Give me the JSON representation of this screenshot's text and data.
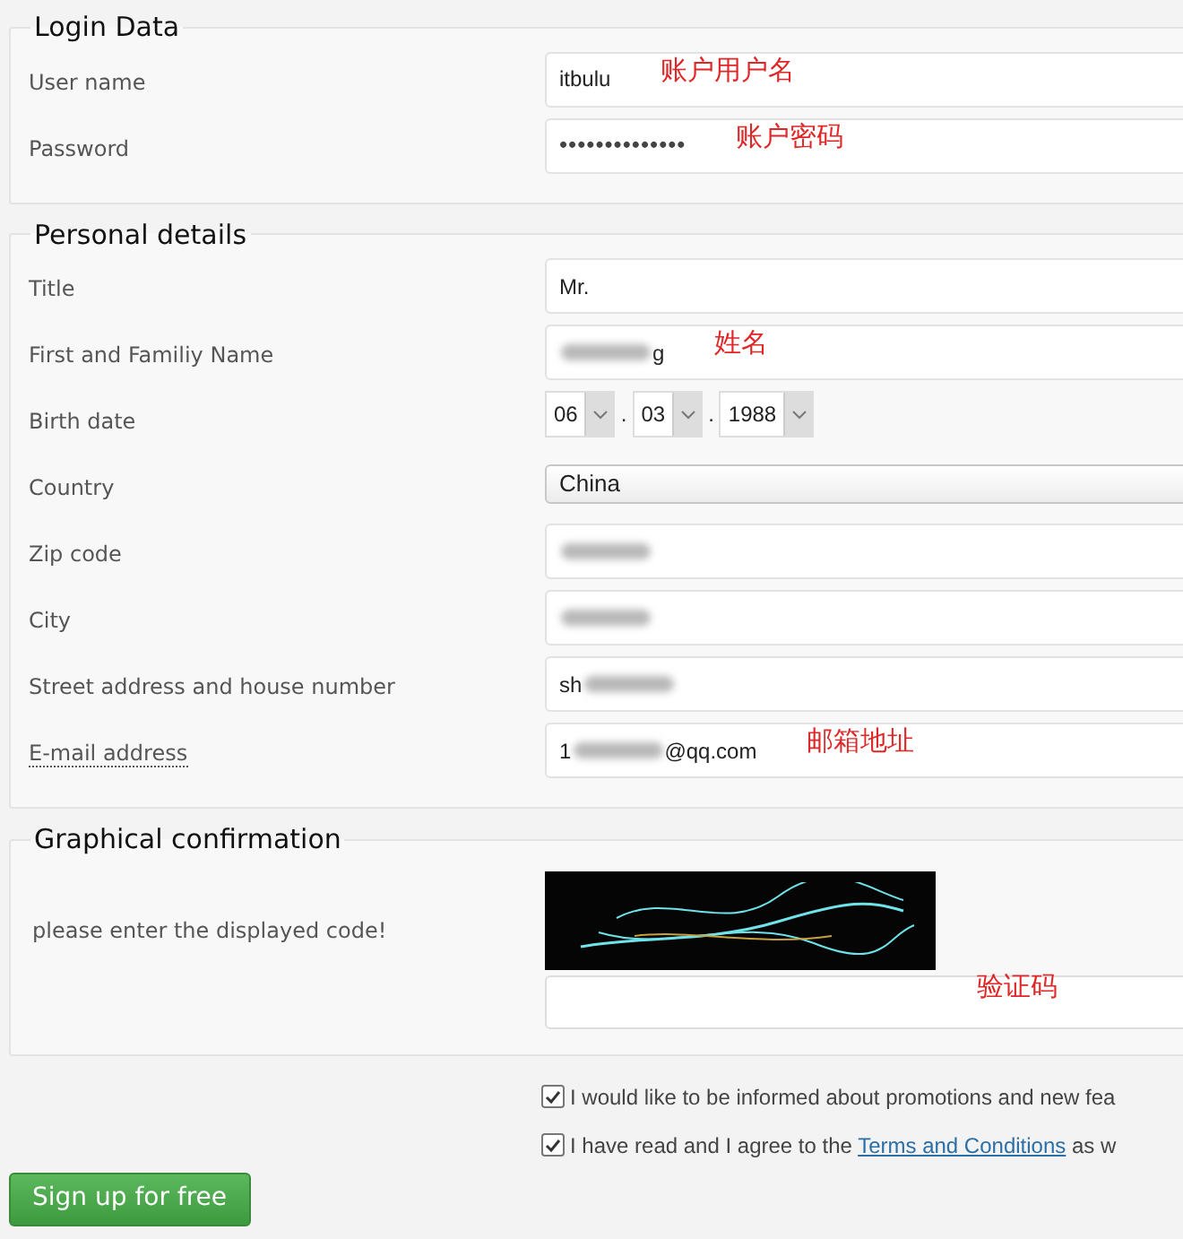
{
  "sections": [
    {
      "legend": "Login Data",
      "rows": [
        {
          "label": "User name",
          "note": "账户用户名",
          "field": {
            "kind": "text",
            "parts": [
              {
                "kind": "text",
                "text": "itbulu"
              }
            ]
          }
        },
        {
          "label": "Password",
          "note": "账户密码",
          "field": {
            "kind": "password",
            "value": "••••••••••••••"
          }
        }
      ]
    },
    {
      "legend": "Personal details",
      "rows": [
        {
          "label": "Title",
          "field": {
            "kind": "text",
            "parts": [
              {
                "kind": "text",
                "text": "Mr."
              }
            ]
          }
        },
        {
          "label": "First and Familiy Name",
          "note": "姓名",
          "field": {
            "kind": "text",
            "parts": [
              {
                "kind": "redacted"
              },
              {
                "kind": "text",
                "text": "g"
              }
            ]
          }
        },
        {
          "label": "Birth date",
          "field": {
            "kind": "date",
            "parts": [
              {
                "kind": "select",
                "value": "06"
              },
              {
                "kind": "sep",
                "text": "."
              },
              {
                "kind": "select",
                "value": "03"
              },
              {
                "kind": "sep",
                "text": "."
              },
              {
                "kind": "select",
                "value": "1988"
              }
            ]
          }
        },
        {
          "label": "Country",
          "field": {
            "kind": "select",
            "value": "China"
          }
        },
        {
          "label": "Zip code",
          "field": {
            "kind": "text",
            "parts": [
              {
                "kind": "redacted"
              }
            ]
          }
        },
        {
          "label": "City",
          "field": {
            "kind": "text",
            "parts": [
              {
                "kind": "redacted"
              }
            ]
          }
        },
        {
          "label": "Street address and house number",
          "field": {
            "kind": "text",
            "parts": [
              {
                "kind": "text",
                "text": "sh"
              },
              {
                "kind": "redacted"
              }
            ]
          }
        },
        {
          "label": "E-mail address",
          "label_underlined": true,
          "note": "邮箱地址",
          "field": {
            "kind": "text",
            "parts": [
              {
                "kind": "text",
                "text": "1"
              },
              {
                "kind": "redacted"
              },
              {
                "kind": "text",
                "text": "@qq.com"
              }
            ]
          }
        }
      ]
    },
    {
      "legend": "Graphical confirmation",
      "rows": [
        {
          "label": "please enter the displayed code!",
          "note": "验证码",
          "field": {
            "kind": "captcha"
          }
        }
      ]
    }
  ],
  "agreements": [
    {
      "checked": true,
      "parts": [
        {
          "kind": "text",
          "text": "I would like to be informed about promotions and new fea"
        }
      ]
    },
    {
      "checked": true,
      "parts": [
        {
          "kind": "text",
          "text": "I have read and I agree to the "
        },
        {
          "kind": "link",
          "text": "Terms and Conditions"
        },
        {
          "kind": "text",
          "text": " as w"
        }
      ]
    }
  ],
  "submit": "Sign up for free"
}
